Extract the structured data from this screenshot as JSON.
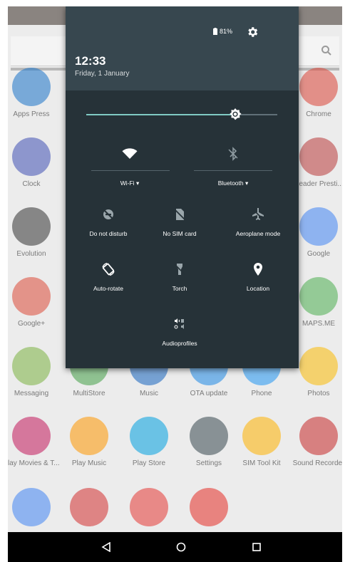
{
  "quick_settings": {
    "time": "12:33",
    "date": "Friday, 1 January",
    "battery": "81%",
    "brightness_level": 0.78,
    "tiles_big": [
      {
        "label": "Wi-Fi",
        "icon": "wifi-icon"
      },
      {
        "label": "Bluetooth",
        "icon": "bluetooth-off-icon"
      }
    ],
    "tiles": [
      {
        "label": "Do not disturb",
        "icon": "do-not-disturb-off-icon"
      },
      {
        "label": "No SIM card",
        "icon": "no-sim-icon"
      },
      {
        "label": "Aeroplane mode",
        "icon": "airplane-off-icon"
      },
      {
        "label": "Auto-rotate",
        "icon": "auto-rotate-icon"
      },
      {
        "label": "Torch",
        "icon": "torch-off-icon"
      },
      {
        "label": "Location",
        "icon": "location-icon"
      },
      {
        "label": "Audioprofiles",
        "icon": "audio-profiles-icon"
      }
    ]
  },
  "apps": [
    {
      "label": "Apps Press",
      "icon": "apps-press-icon",
      "color": "#1a73c8"
    },
    {
      "label": "Chrome",
      "icon": "chrome-icon",
      "color": "#db4437"
    },
    {
      "label": "Clock",
      "icon": "clock-icon",
      "color": "#3f51b5"
    },
    {
      "label": "Reader Presti...",
      "icon": "reader-prestigio-icon",
      "color": "#b93a3a"
    },
    {
      "label": "Evolution",
      "icon": "evolution-icon",
      "color": "#333333"
    },
    {
      "label": "Google",
      "icon": "google-icon",
      "color": "#4285f4"
    },
    {
      "label": "Google+",
      "icon": "google-plus-icon",
      "color": "#dd4b39"
    },
    {
      "label": "MAPS.ME",
      "icon": "maps-me-icon",
      "color": "#4caf50"
    },
    {
      "label": "Messaging",
      "icon": "messaging-icon",
      "color": "#7cb342"
    },
    {
      "label": "MultiStore",
      "icon": "multistore-icon",
      "color": "#43a047"
    },
    {
      "label": "Music",
      "icon": "music-icon",
      "color": "#1565c0"
    },
    {
      "label": "OTA update",
      "icon": "ota-update-icon",
      "color": "#1e88e5"
    },
    {
      "label": "Phone",
      "icon": "phone-icon",
      "color": "#2196f3"
    },
    {
      "label": "Photos",
      "icon": "photos-icon",
      "color": "#fbbc05"
    },
    {
      "label": "Play Movies & T...",
      "icon": "play-movies-icon",
      "color": "#c2185b"
    },
    {
      "label": "Play Music",
      "icon": "play-music-icon",
      "color": "#ff9800"
    },
    {
      "label": "Play Store",
      "icon": "play-store-icon",
      "color": "#00a0e0"
    },
    {
      "label": "Settings",
      "icon": "settings-app-icon",
      "color": "#37474f"
    },
    {
      "label": "SIM Tool Kit",
      "icon": "sim-toolkit-icon",
      "color": "#ffb300"
    },
    {
      "label": "Sound Recorder",
      "icon": "sound-recorder-icon",
      "color": "#c62828"
    },
    {
      "label": "",
      "icon": "voice-search-icon",
      "color": "#4285f4"
    },
    {
      "label": "",
      "icon": "yandex-browser-icon",
      "color": "#d32f2f"
    },
    {
      "label": "",
      "icon": "yandex-icon",
      "color": "#e53935"
    },
    {
      "label": "",
      "icon": "youtube-icon",
      "color": "#e52d27"
    }
  ],
  "navigation": {
    "back": "back-icon",
    "home": "home-icon",
    "recents": "recents-icon"
  }
}
